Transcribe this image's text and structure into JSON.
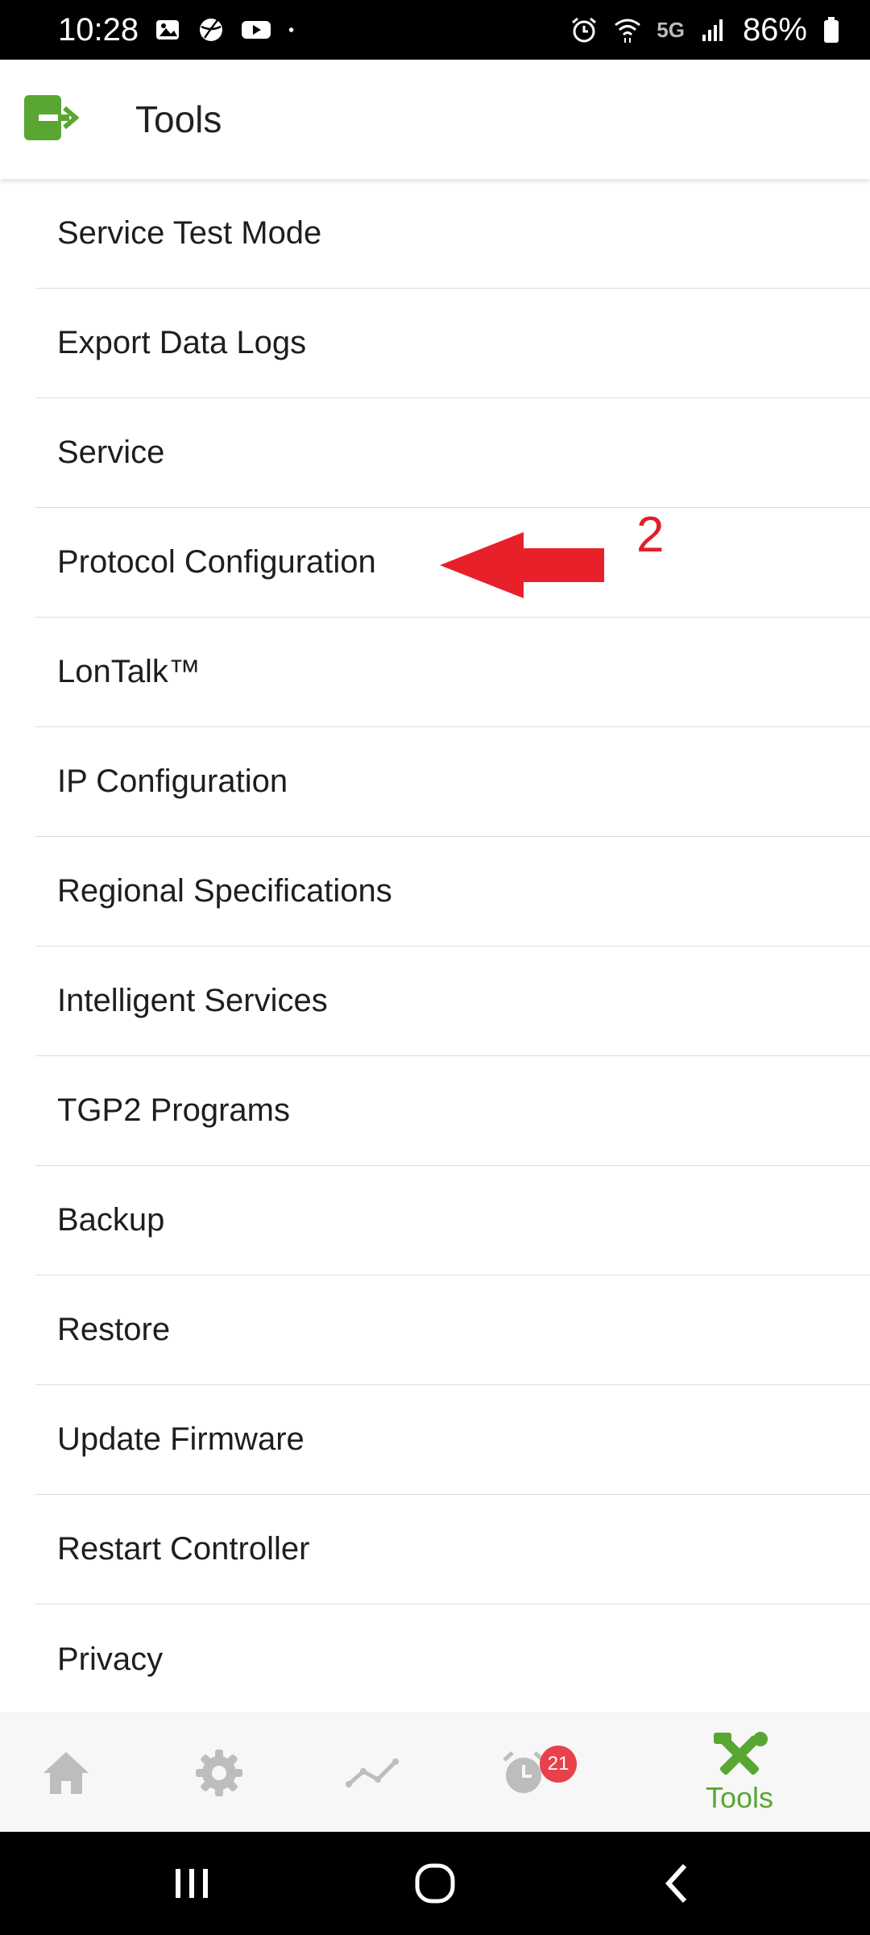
{
  "status_bar": {
    "time": "10:28",
    "network": "5G",
    "battery": "86%",
    "left_icons": [
      "gallery-icon",
      "sports-ball-icon",
      "youtube-icon",
      "dot-icon"
    ],
    "right_icons": [
      "alarm-icon",
      "wifi-icon",
      "signal-icon",
      "battery-icon"
    ]
  },
  "app_bar": {
    "title": "Tools",
    "logo_icon": "exit-logo-icon",
    "accent_color": "#5aa632"
  },
  "menu": {
    "items": [
      {
        "label": "Service Test Mode"
      },
      {
        "label": "Export Data Logs"
      },
      {
        "label": "Service"
      },
      {
        "label": "Protocol Configuration"
      },
      {
        "label": "LonTalk™"
      },
      {
        "label": "IP Configuration"
      },
      {
        "label": "Regional Specifications"
      },
      {
        "label": "Intelligent Services"
      },
      {
        "label": "TGP2 Programs"
      },
      {
        "label": "Backup"
      },
      {
        "label": "Restore"
      },
      {
        "label": "Update Firmware"
      },
      {
        "label": "Restart Controller"
      },
      {
        "label": "Privacy"
      }
    ]
  },
  "annotation": {
    "number": "2",
    "color": "#e0202a",
    "target": "Protocol Configuration"
  },
  "bottom_nav": {
    "items": [
      {
        "icon": "home-icon"
      },
      {
        "icon": "gear-icon"
      },
      {
        "icon": "trend-line-icon"
      },
      {
        "icon": "alarm-clock-icon",
        "badge": "21"
      },
      {
        "icon": "tools-icon",
        "label": "Tools",
        "active": true
      }
    ],
    "inactive_color": "#bdbdbd",
    "active_color": "#5aa632",
    "badge_color": "#e8414b"
  },
  "system_nav": {
    "buttons": [
      "recent-apps-icon",
      "home-circle-icon",
      "back-chevron-icon"
    ]
  }
}
